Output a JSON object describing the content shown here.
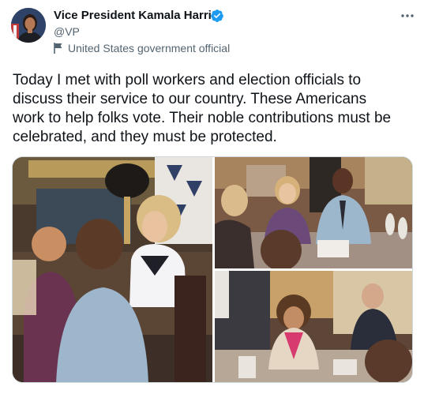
{
  "author": {
    "name": "Vice President Kamala Harris",
    "handle": "@VP",
    "label": "United States government official",
    "verified": true
  },
  "icons": {
    "verified": "verified-badge-icon",
    "flag": "flag-icon",
    "more": "more-options-icon"
  },
  "colors": {
    "text": "#0f1419",
    "secondary": "#536471",
    "verified": "#1d9bf0"
  },
  "tweet": {
    "text_lines": [
      "Today I met with poll workers and election officials to",
      "discuss their service to our country. These Americans",
      "work to help folks vote. Their noble contributions must be",
      "celebrated, and they must be protected."
    ]
  },
  "media": {
    "count": 3
  }
}
